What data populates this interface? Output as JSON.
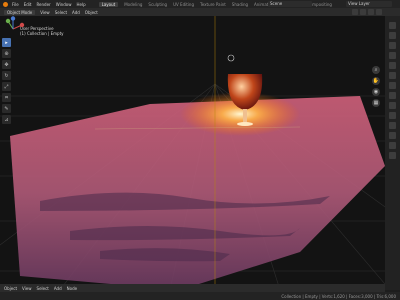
{
  "app": {
    "menus": [
      "File",
      "Edit",
      "Render",
      "Window",
      "Help"
    ],
    "tabs": [
      "Layout",
      "Modeling",
      "Sculpting",
      "UV Editing",
      "Texture Paint",
      "Shading",
      "Animation",
      "Rendering",
      "Compositing"
    ],
    "active_tab_index": 0,
    "scene": "Scene",
    "view_layer": "View Layer"
  },
  "header": {
    "mode": "Object Mode",
    "menus": [
      "View",
      "Select",
      "Add",
      "Object"
    ]
  },
  "viewport": {
    "perspective_label": "User Perspective",
    "collection_label": "(1) Collection | Empty"
  },
  "bottom": {
    "items": [
      "Object",
      "View",
      "Select",
      "Add",
      "Node"
    ]
  },
  "status": {
    "right_text": "Collection | Empty | Verts:1,620 | Faces:3,000 | Tris:6,000"
  },
  "colors": {
    "accent": "#4772b3",
    "blender_orange": "#e87d0d",
    "glow": "#ffb347"
  }
}
